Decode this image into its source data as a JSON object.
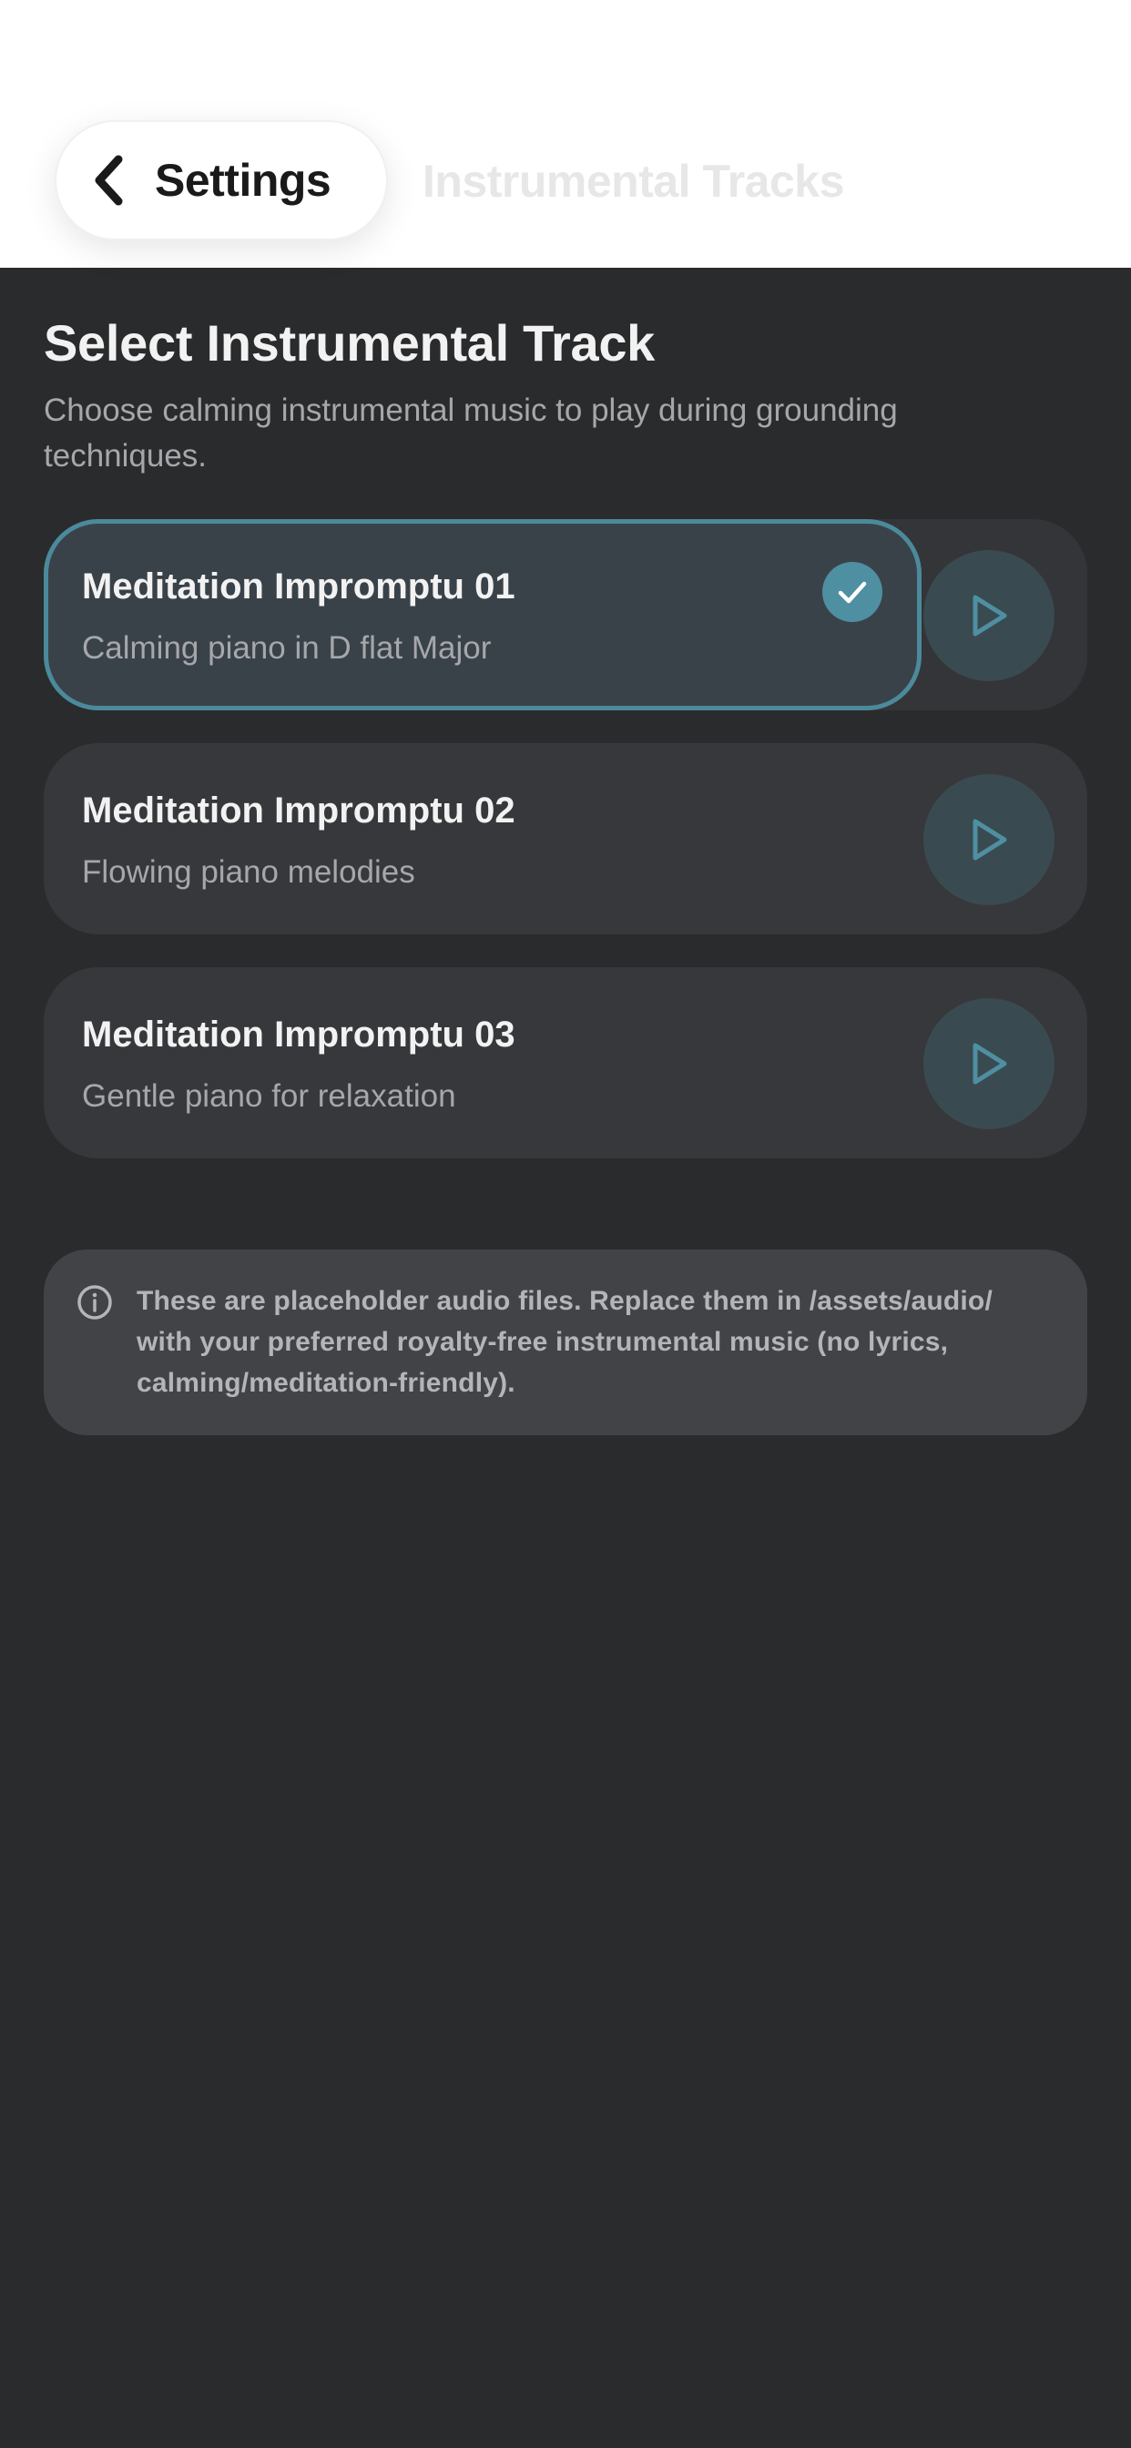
{
  "header": {
    "back_label": "Settings",
    "title": "Instrumental Tracks"
  },
  "main": {
    "title": "Select Instrumental Track",
    "subtitle": "Choose calming instrumental music to play during grounding techniques."
  },
  "tracks": [
    {
      "name": "Meditation Impromptu 01",
      "description": "Calming piano in D flat Major",
      "selected": true
    },
    {
      "name": "Meditation Impromptu 02",
      "description": "Flowing piano melodies",
      "selected": false
    },
    {
      "name": "Meditation Impromptu 03",
      "description": "Gentle piano for relaxation",
      "selected": false
    }
  ],
  "info": {
    "text": "These are placeholder audio files. Replace them in /assets/audio/ with your preferred royalty-free instrumental music (no lyrics, calming/meditation-friendly).",
    "icon": "info-icon"
  },
  "icons": {
    "back": "chevron-left-icon",
    "check": "checkmark-icon",
    "play": "play-icon"
  },
  "colors": {
    "background": "#2a2b2d",
    "card": "#37383b",
    "selected_card": "#3a4249",
    "accent": "#4e8fa1",
    "play_button": "#3a4a51",
    "header": "#ffffff"
  }
}
